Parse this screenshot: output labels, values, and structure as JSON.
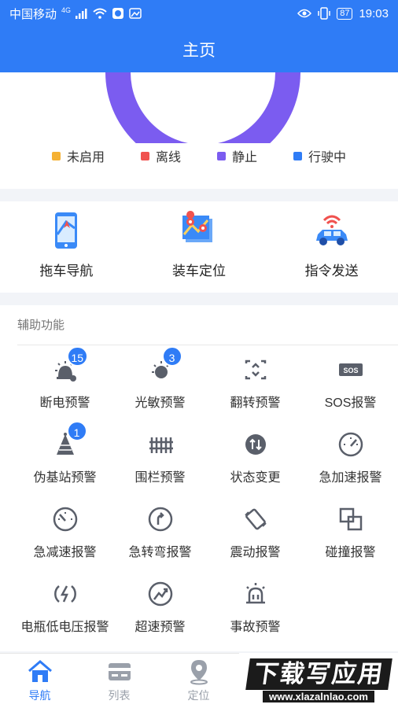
{
  "status_bar": {
    "carrier": "中国移动",
    "network": "4G",
    "battery": "87",
    "time": "19:03"
  },
  "header": {
    "title": "主页"
  },
  "legend": [
    {
      "label": "未启用",
      "color": "#f5b133"
    },
    {
      "label": "离线",
      "color": "#f0524f"
    },
    {
      "label": "静止",
      "color": "#7b5cf0"
    },
    {
      "label": "行驶中",
      "color": "#2f7cf6"
    }
  ],
  "quick_actions": [
    {
      "label": "拖车导航",
      "icon": "phone-map-icon"
    },
    {
      "label": "装车定位",
      "icon": "map-pins-icon"
    },
    {
      "label": "指令发送",
      "icon": "car-signal-icon"
    }
  ],
  "aux": {
    "title": "辅助功能",
    "items": [
      {
        "label": "断电预警",
        "icon": "power-alarm-icon",
        "badge": "15"
      },
      {
        "label": "光敏预警",
        "icon": "light-sensor-icon",
        "badge": "3"
      },
      {
        "label": "翻转预警",
        "icon": "flip-icon",
        "badge": ""
      },
      {
        "label": "SOS报警",
        "icon": "sos-icon",
        "badge": ""
      },
      {
        "label": "伪基站预警",
        "icon": "base-station-icon",
        "badge": "1"
      },
      {
        "label": "围栏预警",
        "icon": "fence-icon",
        "badge": ""
      },
      {
        "label": "状态变更",
        "icon": "status-change-icon",
        "badge": ""
      },
      {
        "label": "急加速报警",
        "icon": "accelerate-icon",
        "badge": ""
      },
      {
        "label": "急减速报警",
        "icon": "decelerate-icon",
        "badge": ""
      },
      {
        "label": "急转弯报警",
        "icon": "sharp-turn-icon",
        "badge": ""
      },
      {
        "label": "震动报警",
        "icon": "vibration-icon",
        "badge": ""
      },
      {
        "label": "碰撞报警",
        "icon": "collision-icon",
        "badge": ""
      },
      {
        "label": "电瓶低电压报警",
        "icon": "low-voltage-icon",
        "badge": ""
      },
      {
        "label": "超速预警",
        "icon": "overspeed-icon",
        "badge": ""
      },
      {
        "label": "事故预警",
        "icon": "accident-icon",
        "badge": ""
      }
    ]
  },
  "tabs": [
    {
      "label": "导航",
      "icon": "home-icon",
      "active": true
    },
    {
      "label": "列表",
      "icon": "list-card-icon",
      "active": false
    },
    {
      "label": "定位",
      "icon": "location-pin-icon",
      "active": false
    }
  ],
  "watermark": {
    "main": "下载写应用",
    "url": "www.xlazalnlao.com"
  }
}
